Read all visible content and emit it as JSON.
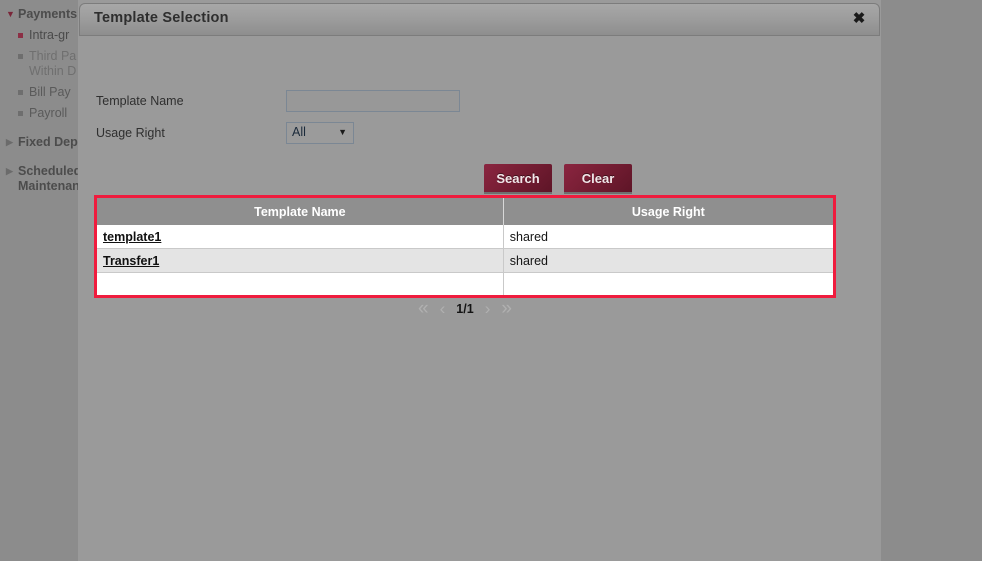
{
  "sidebar": {
    "groups": [
      {
        "label": "Payments",
        "icon": "triangle-down-icon",
        "expanded": true,
        "items": [
          {
            "label": "Intra-gr",
            "active": true
          },
          {
            "label": "Third Pa\nWithin D",
            "active": false,
            "dim": true
          },
          {
            "label": "Bill Pay",
            "active": false
          },
          {
            "label": "Payroll",
            "active": false
          }
        ]
      },
      {
        "label": "Fixed Dep",
        "icon": "triangle-right-icon",
        "expanded": false,
        "items": []
      },
      {
        "label": "Scheduled\nMaintenan",
        "icon": "triangle-right-icon",
        "expanded": false,
        "items": []
      }
    ]
  },
  "modal": {
    "title": "Template Selection",
    "close_label": "✖",
    "form": {
      "template_name_label": "Template Name",
      "template_name_value": "",
      "template_name_placeholder": "",
      "usage_right_label": "Usage Right",
      "usage_right_value": "All",
      "usage_right_arrow": "▼",
      "usage_right_options": [
        "All"
      ]
    },
    "actions": {
      "search_label": "Search",
      "clear_label": "Clear"
    },
    "results": {
      "columns": [
        "Template Name",
        "Usage Right"
      ],
      "rows": [
        {
          "template_name": "template1",
          "usage_right": "shared"
        },
        {
          "template_name": "Transfer1",
          "usage_right": "shared"
        }
      ],
      "blank_row": true
    },
    "pager": {
      "first": "«",
      "prev": "‹",
      "count": "1/1",
      "next": "›",
      "last": "»"
    }
  },
  "colors": {
    "accent_red": "#ef1c3e",
    "button_maroon": "#7a1f36",
    "header_gray": "#8f8f8f",
    "overlay_gray": "#9a9a9a",
    "page_gray": "#8c8c8c"
  }
}
